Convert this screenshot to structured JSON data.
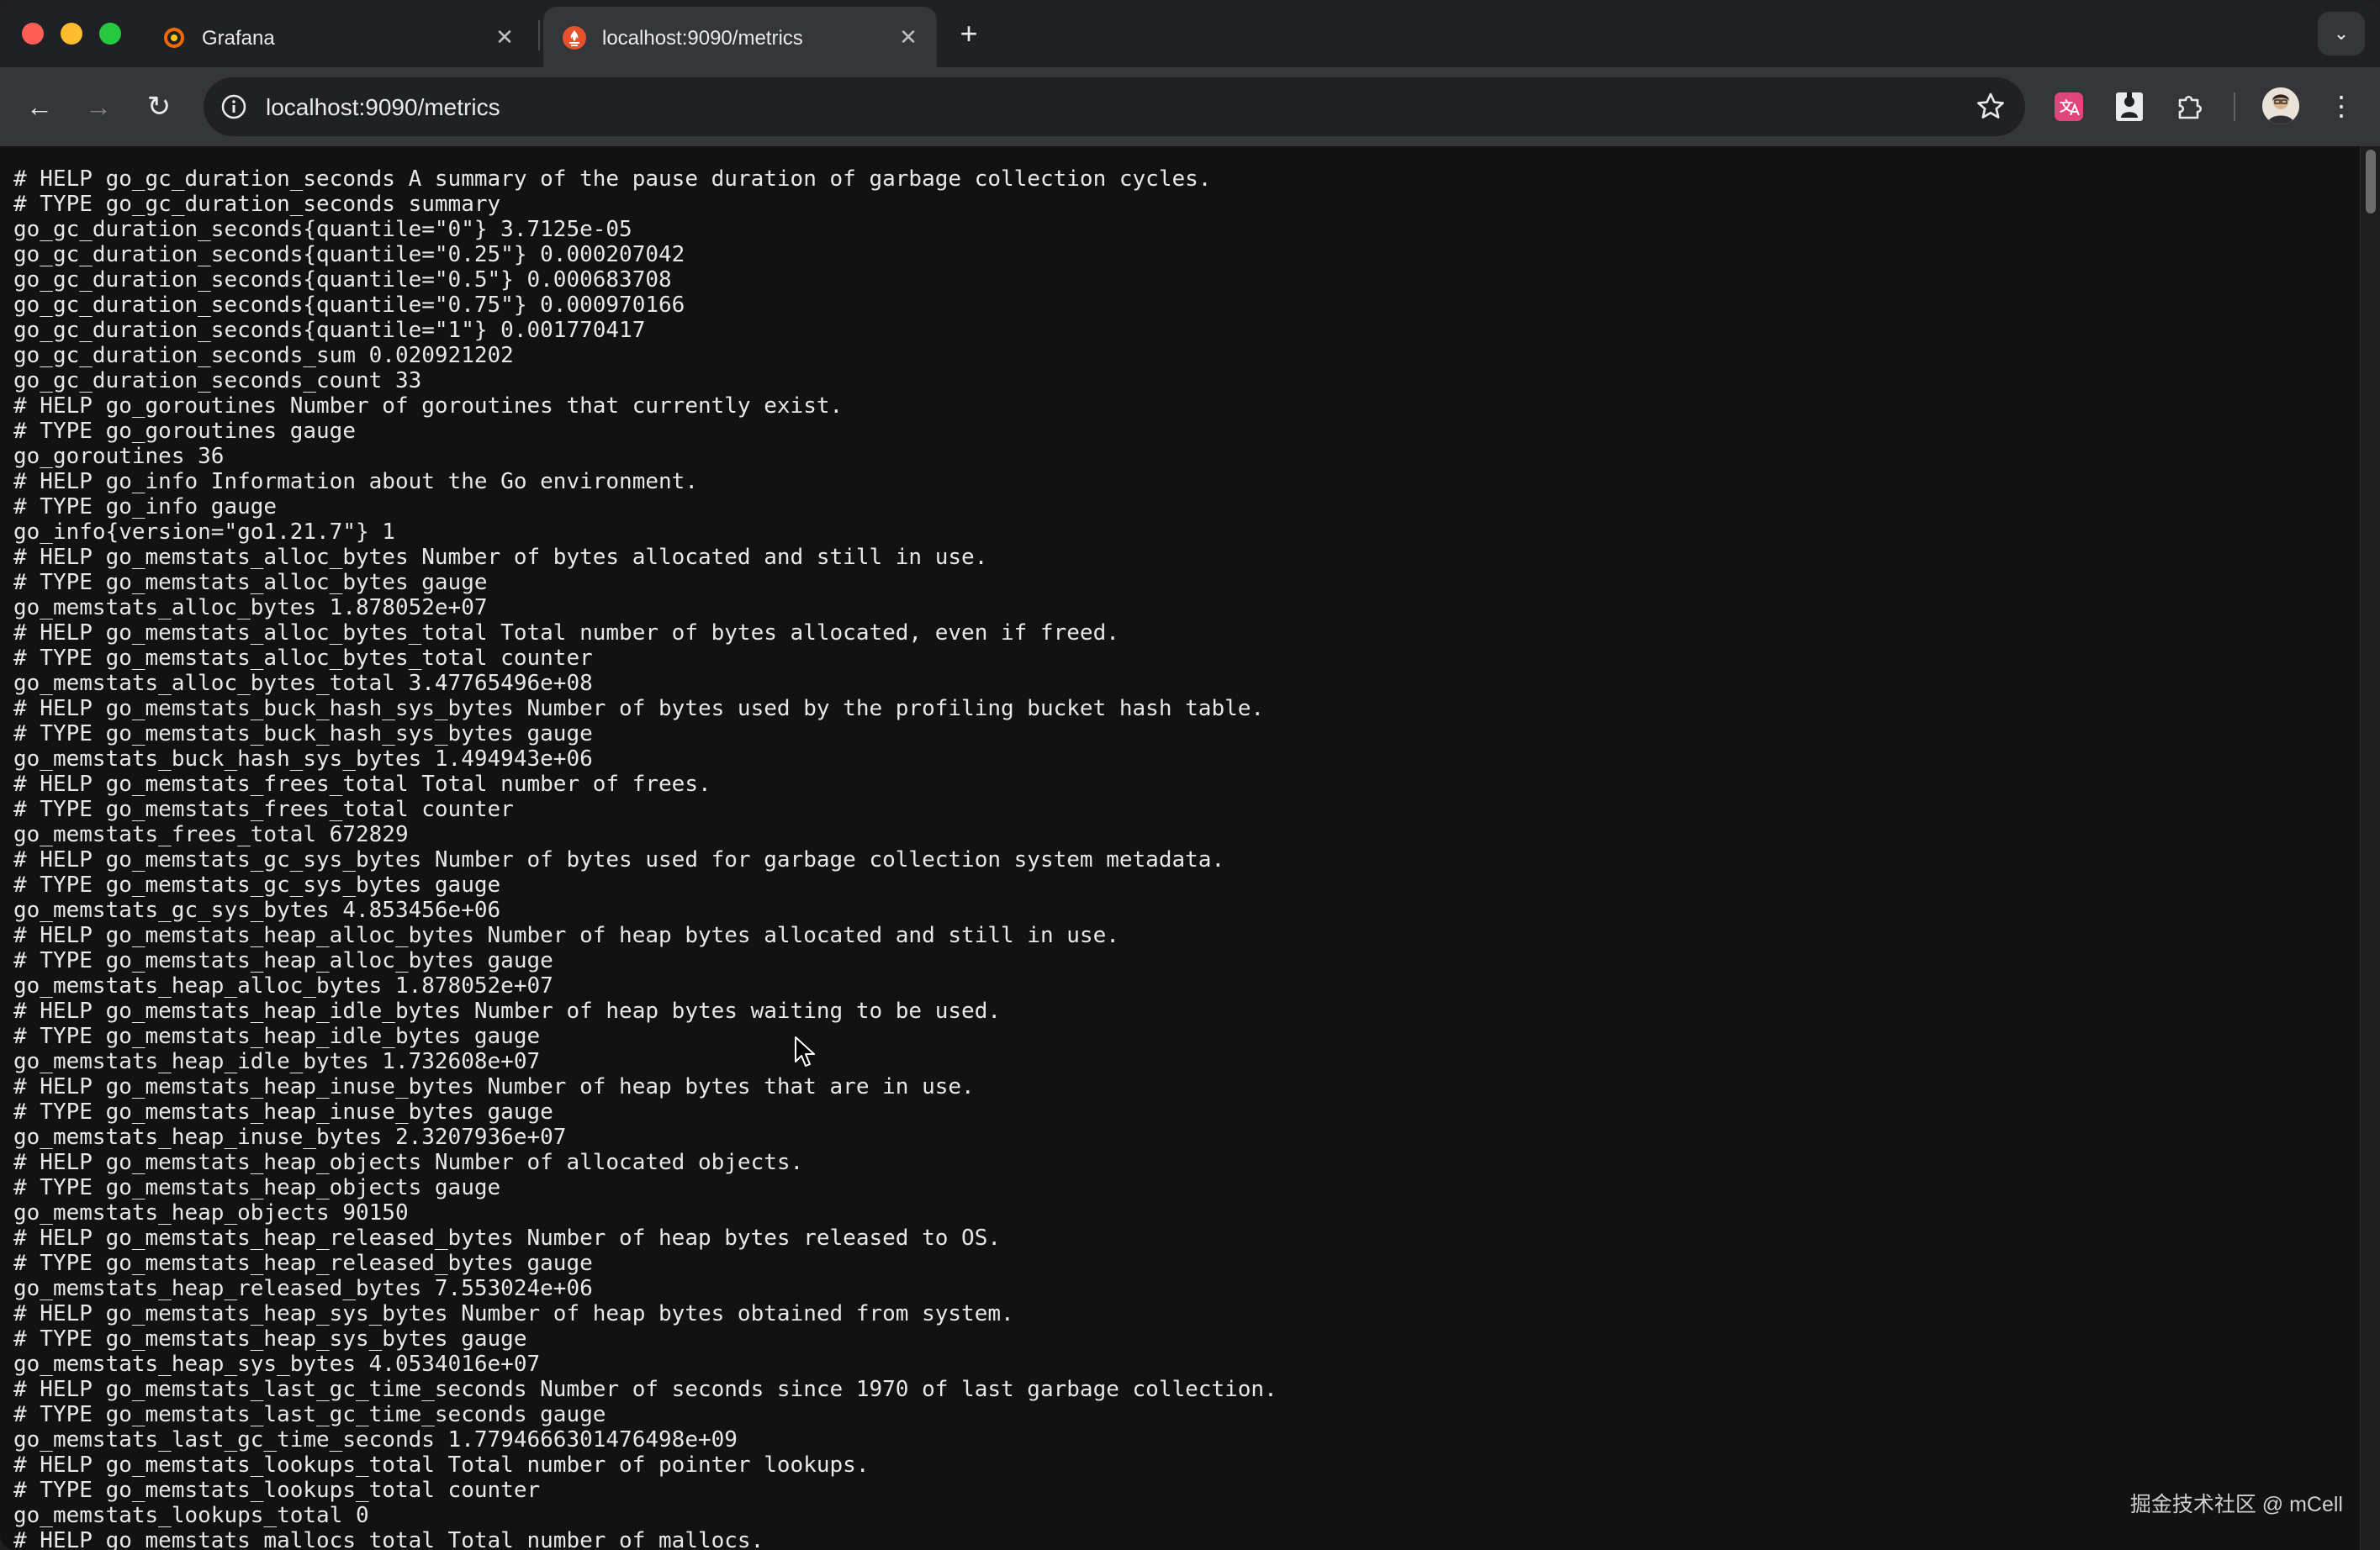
{
  "tabs": [
    {
      "title": "Grafana",
      "favicon": "grafana-icon",
      "active": false
    },
    {
      "title": "localhost:9090/metrics",
      "favicon": "prometheus-icon",
      "active": true
    }
  ],
  "tab_close_glyph": "✕",
  "new_tab_glyph": "+",
  "tab_search_glyph": "⌄",
  "toolbar": {
    "back_glyph": "←",
    "forward_glyph": "→",
    "reload_glyph": "↻",
    "menu_glyph": "⋮"
  },
  "address_bar": {
    "url": "localhost:9090/metrics"
  },
  "extensions": [
    "translate-extension-icon",
    "bookmark-extension-icon",
    "extensions-puzzle-icon"
  ],
  "metrics_lines": [
    "# HELP go_gc_duration_seconds A summary of the pause duration of garbage collection cycles.",
    "# TYPE go_gc_duration_seconds summary",
    "go_gc_duration_seconds{quantile=\"0\"} 3.7125e-05",
    "go_gc_duration_seconds{quantile=\"0.25\"} 0.000207042",
    "go_gc_duration_seconds{quantile=\"0.5\"} 0.000683708",
    "go_gc_duration_seconds{quantile=\"0.75\"} 0.000970166",
    "go_gc_duration_seconds{quantile=\"1\"} 0.001770417",
    "go_gc_duration_seconds_sum 0.020921202",
    "go_gc_duration_seconds_count 33",
    "# HELP go_goroutines Number of goroutines that currently exist.",
    "# TYPE go_goroutines gauge",
    "go_goroutines 36",
    "# HELP go_info Information about the Go environment.",
    "# TYPE go_info gauge",
    "go_info{version=\"go1.21.7\"} 1",
    "# HELP go_memstats_alloc_bytes Number of bytes allocated and still in use.",
    "# TYPE go_memstats_alloc_bytes gauge",
    "go_memstats_alloc_bytes 1.878052e+07",
    "# HELP go_memstats_alloc_bytes_total Total number of bytes allocated, even if freed.",
    "# TYPE go_memstats_alloc_bytes_total counter",
    "go_memstats_alloc_bytes_total 3.47765496e+08",
    "# HELP go_memstats_buck_hash_sys_bytes Number of bytes used by the profiling bucket hash table.",
    "# TYPE go_memstats_buck_hash_sys_bytes gauge",
    "go_memstats_buck_hash_sys_bytes 1.494943e+06",
    "# HELP go_memstats_frees_total Total number of frees.",
    "# TYPE go_memstats_frees_total counter",
    "go_memstats_frees_total 672829",
    "# HELP go_memstats_gc_sys_bytes Number of bytes used for garbage collection system metadata.",
    "# TYPE go_memstats_gc_sys_bytes gauge",
    "go_memstats_gc_sys_bytes 4.853456e+06",
    "# HELP go_memstats_heap_alloc_bytes Number of heap bytes allocated and still in use.",
    "# TYPE go_memstats_heap_alloc_bytes gauge",
    "go_memstats_heap_alloc_bytes 1.878052e+07",
    "# HELP go_memstats_heap_idle_bytes Number of heap bytes waiting to be used.",
    "# TYPE go_memstats_heap_idle_bytes gauge",
    "go_memstats_heap_idle_bytes 1.732608e+07",
    "# HELP go_memstats_heap_inuse_bytes Number of heap bytes that are in use.",
    "# TYPE go_memstats_heap_inuse_bytes gauge",
    "go_memstats_heap_inuse_bytes 2.3207936e+07",
    "# HELP go_memstats_heap_objects Number of allocated objects.",
    "# TYPE go_memstats_heap_objects gauge",
    "go_memstats_heap_objects 90150",
    "# HELP go_memstats_heap_released_bytes Number of heap bytes released to OS.",
    "# TYPE go_memstats_heap_released_bytes gauge",
    "go_memstats_heap_released_bytes 7.553024e+06",
    "# HELP go_memstats_heap_sys_bytes Number of heap bytes obtained from system.",
    "# TYPE go_memstats_heap_sys_bytes gauge",
    "go_memstats_heap_sys_bytes 4.0534016e+07",
    "# HELP go_memstats_last_gc_time_seconds Number of seconds since 1970 of last garbage collection.",
    "# TYPE go_memstats_last_gc_time_seconds gauge",
    "go_memstats_last_gc_time_seconds 1.7794666301476498e+09",
    "# HELP go_memstats_lookups_total Total number of pointer lookups.",
    "# TYPE go_memstats_lookups_total counter",
    "go_memstats_lookups_total 0",
    "# HELP go_memstats_mallocs_total Total number of mallocs."
  ],
  "watermark": "掘金技术社区 @ mCell",
  "colors": {
    "tab_strip": "#202124",
    "toolbar": "#35363a",
    "page_background": "#121212",
    "page_text": "#e8e8e8"
  }
}
